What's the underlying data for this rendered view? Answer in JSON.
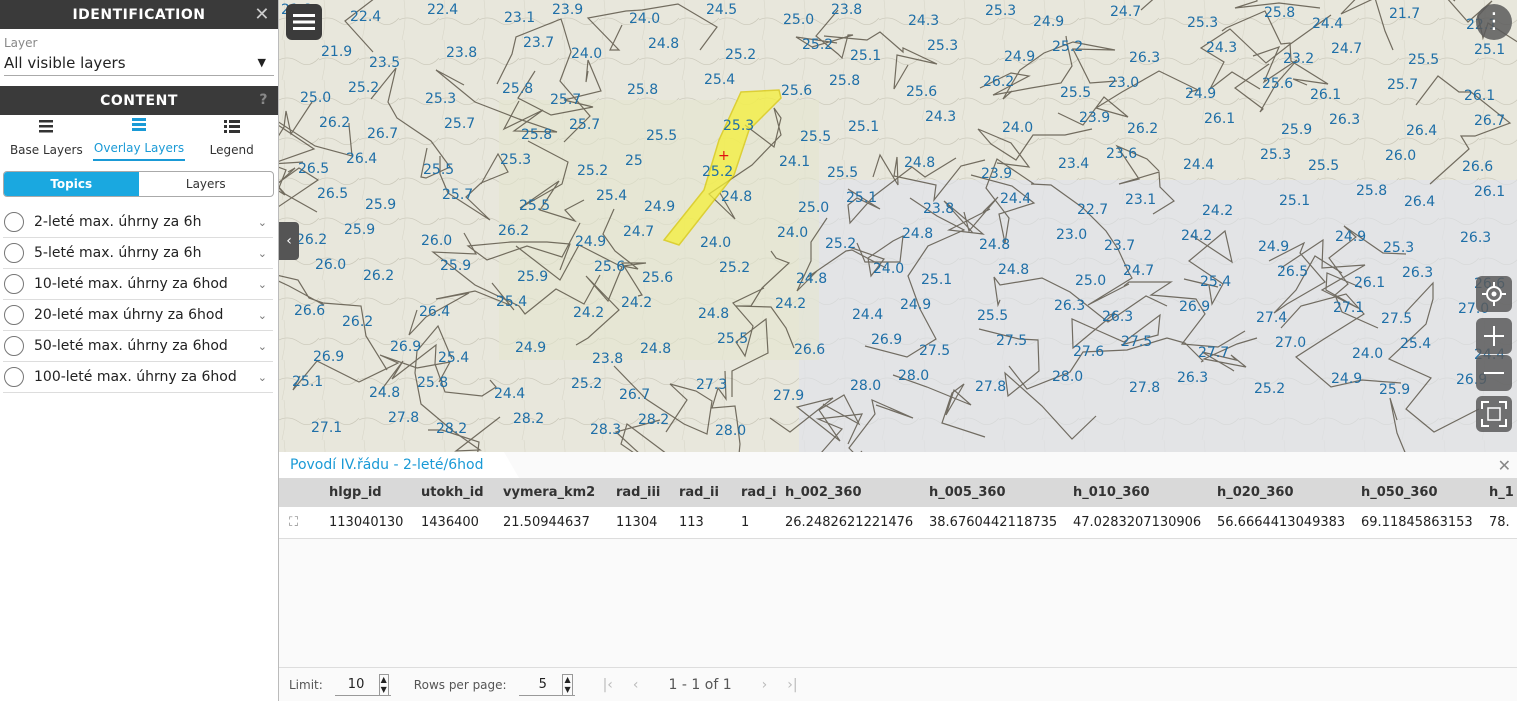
{
  "identification": {
    "title": "IDENTIFICATION",
    "layer_label": "Layer",
    "layer_value": "All visible layers"
  },
  "content": {
    "title": "CONTENT",
    "help": "?",
    "tabs": [
      {
        "label": "Base Layers",
        "icon": "layers-stack-icon",
        "active": false
      },
      {
        "label": "Overlay Layers",
        "icon": "overlay-layers-icon",
        "active": true
      },
      {
        "label": "Legend",
        "icon": "legend-list-icon",
        "active": false
      }
    ],
    "segments": [
      {
        "label": "Topics",
        "active": true
      },
      {
        "label": "Layers",
        "active": false
      }
    ],
    "topics": [
      {
        "label": "2-leté max. úhrny za 6h"
      },
      {
        "label": "5-leté max. úhrny za 6h"
      },
      {
        "label": "10-leté max. úhrny za 6hod"
      },
      {
        "label": "20-leté max úhrny za 6hod"
      },
      {
        "label": "50-leté max. úhrny za 6hod"
      },
      {
        "label": "100-leté max. úhrny za 6hod"
      }
    ]
  },
  "map": {
    "colors": {
      "accent": "#1a9ad6",
      "highlight": "#f5f03a",
      "label": "#1f6fa7"
    },
    "labels": [
      "21.8",
      "22.4",
      "22.4",
      "23.1",
      "23.9",
      "24.0",
      "24.5",
      "25.0",
      "23.8",
      "24.3",
      "25.3",
      "24.9",
      "24.7",
      "25.3",
      "25.8",
      "24.4",
      "21.7",
      "22.1",
      "21.9",
      "23.5",
      "23.8",
      "23.7",
      "24.0",
      "24.8",
      "25.2",
      "25.2",
      "25.1",
      "25.3",
      "24.9",
      "25.2",
      "26.3",
      "24.3",
      "23.2",
      "24.7",
      "25.5",
      "25.1",
      "25.0",
      "25.2",
      "25.3",
      "25.8",
      "25.7",
      "25.8",
      "25.4",
      "25.6",
      "25.8",
      "25.6",
      "26.2",
      "25.5",
      "23.0",
      "24.9",
      "25.6",
      "26.1",
      "25.7",
      "26.1",
      "26.2",
      "26.7",
      "25.7",
      "25.8",
      "25.7",
      "25.5",
      "25.3",
      "25.5",
      "25.1",
      "24.3",
      "24.0",
      "23.9",
      "26.2",
      "26.1",
      "25.9",
      "26.3",
      "26.4",
      "26.7",
      "26.5",
      "26.4",
      "25.5",
      "25.3",
      "25.2",
      "25",
      "25.2",
      "24.1",
      "25.5",
      "24.8",
      "23.9",
      "23.4",
      "23.6",
      "24.4",
      "25.3",
      "25.5",
      "26.0",
      "26.6",
      "26.5",
      "25.9",
      "25.7",
      "25.5",
      "25.4",
      "24.9",
      "24.8",
      "25.0",
      "25.1",
      "23.8",
      "24.4",
      "22.7",
      "23.1",
      "24.2",
      "25.1",
      "25.8",
      "26.4",
      "26.1",
      "26.2",
      "25.9",
      "26.0",
      "26.2",
      "24.9",
      "24.7",
      "24.0",
      "24.0",
      "25.2",
      "24.8",
      "24.8",
      "23.0",
      "23.7",
      "24.2",
      "24.9",
      "24.9",
      "25.3",
      "26.3",
      "26.0",
      "26.2",
      "25.9",
      "25.9",
      "25.6",
      "25.6",
      "25.2",
      "24.8",
      "24.0",
      "25.1",
      "24.8",
      "25.0",
      "24.7",
      "25.4",
      "26.5",
      "26.1",
      "26.3",
      "26.6",
      "26.6",
      "26.2",
      "26.4",
      "25.4",
      "24.2",
      "24.2",
      "24.8",
      "24.2",
      "24.4",
      "24.9",
      "25.5",
      "26.3",
      "26.3",
      "26.9",
      "27.4",
      "27.1",
      "27.5",
      "27.0",
      "26.9",
      "26.9",
      "25.4",
      "24.9",
      "23.8",
      "24.8",
      "25.5",
      "26.6",
      "26.9",
      "27.5",
      "27.5",
      "27.6",
      "27.5",
      "27.7",
      "27.0",
      "24.0",
      "25.4",
      "24.4",
      "25.1",
      "24.8",
      "25.8",
      "24.4",
      "25.2",
      "26.7",
      "27.3",
      "27.9",
      "28.0",
      "28.0",
      "27.8",
      "28.0",
      "27.8",
      "26.3",
      "25.2",
      "24.9",
      "25.9",
      "26.9",
      "27.1",
      "27.8",
      "28.2",
      "28.2",
      "28.3",
      "28.2",
      "28.0"
    ]
  },
  "grid": {
    "tab_title": "Povodí IV.řádu - 2-leté/6hod",
    "columns": [
      "hlgp_id",
      "utokh_id",
      "vymera_km2",
      "rad_iii",
      "rad_ii",
      "rad_i",
      "h_002_360",
      "h_005_360",
      "h_010_360",
      "h_020_360",
      "h_050_360",
      "h_1"
    ],
    "row": [
      "113040130",
      "1436400",
      "21.50944637",
      "11304",
      "113",
      "1",
      "26.2482621221476",
      "38.6760442118735",
      "47.0283207130906",
      "56.6664413049383",
      "69.11845863153",
      "78."
    ],
    "footer": {
      "limit_label": "Limit:",
      "limit_value": "10",
      "rows_label": "Rows per page:",
      "rows_value": "5",
      "range": "1 - 1 of 1"
    }
  }
}
